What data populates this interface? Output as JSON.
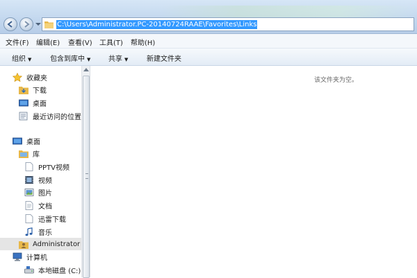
{
  "address": {
    "path": "C:\\Users\\Administrator.PC-20140724RAAE\\Favorites\\Links"
  },
  "menu": [
    "文件(F)",
    "编辑(E)",
    "查看(V)",
    "工具(T)",
    "帮助(H)"
  ],
  "toolbar": {
    "organize": "组织",
    "include": "包含到库中",
    "share": "共享",
    "new_folder": "新建文件夹"
  },
  "nav": {
    "favorites": {
      "label": "收藏夹",
      "items": [
        "下载",
        "桌面",
        "最近访问的位置"
      ]
    },
    "desktop": "桌面",
    "library": {
      "label": "库",
      "items": [
        "PPTV视频",
        "视频",
        "图片",
        "文档",
        "迅雷下载",
        "音乐"
      ]
    },
    "user": "Administrator",
    "computer": {
      "label": "计算机",
      "items": [
        "本地磁盘 (C:)"
      ]
    }
  },
  "content": {
    "empty_message": "该文件夹为空。"
  },
  "colors": {
    "selection": "#3399ff",
    "folder": "#e8b84a",
    "titlebar": "#c2d7ee"
  }
}
